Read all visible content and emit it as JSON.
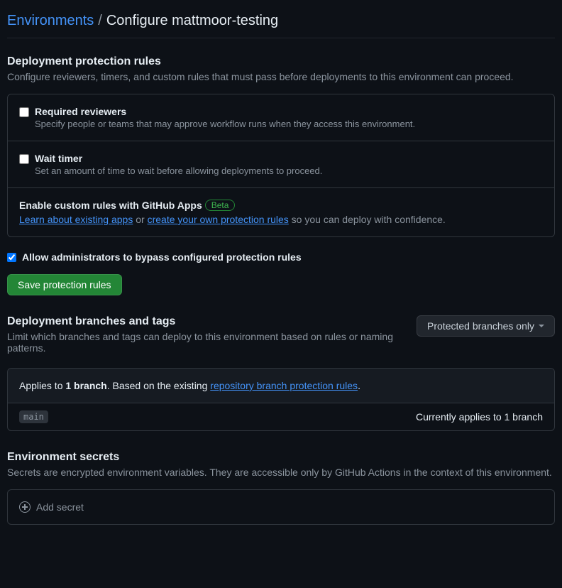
{
  "breadcrumb": {
    "parent": "Environments",
    "separator": "/",
    "current": "Configure mattmoor-testing"
  },
  "protection": {
    "title": "Deployment protection rules",
    "desc": "Configure reviewers, timers, and custom rules that must pass before deployments to this environment can proceed.",
    "required_reviewers": {
      "label": "Required reviewers",
      "desc": "Specify people or teams that may approve workflow runs when they access this environment."
    },
    "wait_timer": {
      "label": "Wait timer",
      "desc": "Set an amount of time to wait before allowing deployments to proceed."
    },
    "custom_rules": {
      "title": "Enable custom rules with GitHub Apps",
      "badge": "Beta",
      "learn_link": "Learn about existing apps",
      "or_text": " or ",
      "create_link": "create your own protection rules",
      "tail": " so you can deploy with confidence."
    },
    "admin_bypass": "Allow administrators to bypass configured protection rules",
    "save_button": "Save protection rules"
  },
  "branches": {
    "title": "Deployment branches and tags",
    "desc": "Limit which branches and tags can deploy to this environment based on rules or naming patterns.",
    "dropdown": "Protected branches only",
    "applies_prefix": "Applies to ",
    "applies_count": "1 branch",
    "applies_mid": ". Based on the existing ",
    "applies_link": "repository branch protection rules",
    "applies_suffix": ".",
    "branch_name": "main",
    "current_text": "Currently applies to 1 branch"
  },
  "secrets": {
    "title": "Environment secrets",
    "desc": "Secrets are encrypted environment variables. They are accessible only by GitHub Actions in the context of this environment.",
    "add_label": "Add secret"
  }
}
